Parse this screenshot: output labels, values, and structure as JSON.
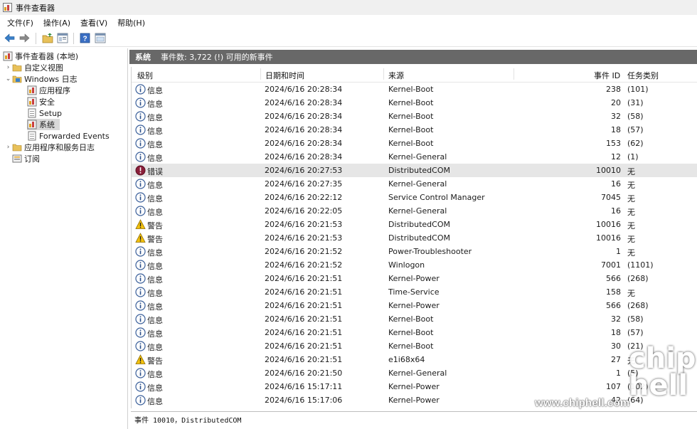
{
  "window": {
    "title": "事件查看器"
  },
  "menu": [
    "文件(F)",
    "操作(A)",
    "查看(V)",
    "帮助(H)"
  ],
  "toolbar": {
    "buttons": [
      "back-icon",
      "forward-icon",
      "folder-up-icon",
      "properties-icon",
      "help-icon",
      "show-pane-icon"
    ]
  },
  "tree": {
    "root": "事件查看器 (本地)",
    "custom_views": "自定义视图",
    "windows_logs": "Windows 日志",
    "application": "应用程序",
    "security": "安全",
    "setup": "Setup",
    "system": "系统",
    "forwarded": "Forwarded Events",
    "app_services": "应用程序和服务日志",
    "subscriptions": "订阅"
  },
  "panel": {
    "title": "系统",
    "info": "事件数: 3,722 (!) 可用的新事件"
  },
  "columns": {
    "level": "级别",
    "datetime": "日期和时间",
    "source": "来源",
    "event_id": "事件 ID",
    "task": "任务类别"
  },
  "events": [
    {
      "level": "信息",
      "type": "info",
      "datetime": "2024/6/16 20:28:34",
      "source": "Kernel-Boot",
      "event_id": "238",
      "task": "(101)"
    },
    {
      "level": "信息",
      "type": "info",
      "datetime": "2024/6/16 20:28:34",
      "source": "Kernel-Boot",
      "event_id": "20",
      "task": "(31)"
    },
    {
      "level": "信息",
      "type": "info",
      "datetime": "2024/6/16 20:28:34",
      "source": "Kernel-Boot",
      "event_id": "32",
      "task": "(58)"
    },
    {
      "level": "信息",
      "type": "info",
      "datetime": "2024/6/16 20:28:34",
      "source": "Kernel-Boot",
      "event_id": "18",
      "task": "(57)"
    },
    {
      "level": "信息",
      "type": "info",
      "datetime": "2024/6/16 20:28:34",
      "source": "Kernel-Boot",
      "event_id": "153",
      "task": "(62)"
    },
    {
      "level": "信息",
      "type": "info",
      "datetime": "2024/6/16 20:28:34",
      "source": "Kernel-General",
      "event_id": "12",
      "task": "(1)"
    },
    {
      "level": "错误",
      "type": "error",
      "datetime": "2024/6/16 20:27:53",
      "source": "DistributedCOM",
      "event_id": "10010",
      "task": "无",
      "selected": true
    },
    {
      "level": "信息",
      "type": "info",
      "datetime": "2024/6/16 20:27:35",
      "source": "Kernel-General",
      "event_id": "16",
      "task": "无"
    },
    {
      "level": "信息",
      "type": "info",
      "datetime": "2024/6/16 20:22:12",
      "source": "Service Control Manager",
      "event_id": "7045",
      "task": "无"
    },
    {
      "level": "信息",
      "type": "info",
      "datetime": "2024/6/16 20:22:05",
      "source": "Kernel-General",
      "event_id": "16",
      "task": "无"
    },
    {
      "level": "警告",
      "type": "warning",
      "datetime": "2024/6/16 20:21:53",
      "source": "DistributedCOM",
      "event_id": "10016",
      "task": "无"
    },
    {
      "level": "警告",
      "type": "warning",
      "datetime": "2024/6/16 20:21:53",
      "source": "DistributedCOM",
      "event_id": "10016",
      "task": "无"
    },
    {
      "level": "信息",
      "type": "info",
      "datetime": "2024/6/16 20:21:52",
      "source": "Power-Troubleshooter",
      "event_id": "1",
      "task": "无"
    },
    {
      "level": "信息",
      "type": "info",
      "datetime": "2024/6/16 20:21:52",
      "source": "Winlogon",
      "event_id": "7001",
      "task": "(1101)"
    },
    {
      "level": "信息",
      "type": "info",
      "datetime": "2024/6/16 20:21:51",
      "source": "Kernel-Power",
      "event_id": "566",
      "task": "(268)"
    },
    {
      "level": "信息",
      "type": "info",
      "datetime": "2024/6/16 20:21:51",
      "source": "Time-Service",
      "event_id": "158",
      "task": "无"
    },
    {
      "level": "信息",
      "type": "info",
      "datetime": "2024/6/16 20:21:51",
      "source": "Kernel-Power",
      "event_id": "566",
      "task": "(268)"
    },
    {
      "level": "信息",
      "type": "info",
      "datetime": "2024/6/16 20:21:51",
      "source": "Kernel-Boot",
      "event_id": "32",
      "task": "(58)"
    },
    {
      "level": "信息",
      "type": "info",
      "datetime": "2024/6/16 20:21:51",
      "source": "Kernel-Boot",
      "event_id": "18",
      "task": "(57)"
    },
    {
      "level": "信息",
      "type": "info",
      "datetime": "2024/6/16 20:21:51",
      "source": "Kernel-Boot",
      "event_id": "30",
      "task": "(21)"
    },
    {
      "level": "警告",
      "type": "warning",
      "datetime": "2024/6/16 20:21:51",
      "source": "e1i68x64",
      "event_id": "27",
      "task": "无"
    },
    {
      "level": "信息",
      "type": "info",
      "datetime": "2024/6/16 20:21:50",
      "source": "Kernel-General",
      "event_id": "1",
      "task": "(5)"
    },
    {
      "level": "信息",
      "type": "info",
      "datetime": "2024/6/16 15:17:11",
      "source": "Kernel-Power",
      "event_id": "107",
      "task": "(102)"
    },
    {
      "level": "信息",
      "type": "info",
      "datetime": "2024/6/16 15:17:06",
      "source": "Kernel-Power",
      "event_id": "42",
      "task": "(64)"
    }
  ],
  "status": "事件 10010，DistributedCOM",
  "watermark": {
    "url": "www.chiphell.com",
    "logo": "chip hell"
  }
}
